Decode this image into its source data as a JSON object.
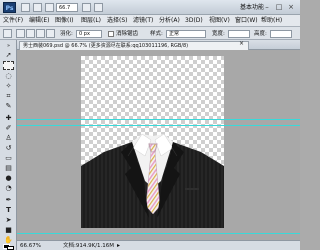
{
  "app": {
    "logo": "Ps",
    "zoom": "66.7",
    "workspace": "基本功能",
    "window_controls": [
      "–",
      "□",
      "×"
    ]
  },
  "menu": [
    "文件(F)",
    "编辑(E)",
    "图像(I)",
    "图层(L)",
    "选择(S)",
    "滤镜(T)",
    "分析(A)",
    "3D(D)",
    "视图(V)",
    "窗口(W)",
    "帮助(H)"
  ],
  "options": {
    "feather_label": "羽化:",
    "feather_value": "0 px",
    "antialias_label": "消除锯齿",
    "style_label": "样式:",
    "style_value": "正常",
    "width_label": "宽度:",
    "height_label": "高度:"
  },
  "document": {
    "tab_title": "男士西装069.psd @ 66.7% (更多资源尽在联系:qq103011196, RGB/8)",
    "close": "×"
  },
  "status": {
    "zoom": "66.67%",
    "doc_info": "文档:914.9K/1.16M"
  },
  "colors": {
    "guide": "#3ad9d9",
    "suit": "#1d1d1d",
    "shirt": "#f2f2f2",
    "tie_stripe_pink": "#e8a0c8",
    "tie_stripe_gold": "#d9b24a"
  },
  "icons": [
    "photoshop-logo",
    "hand-icon",
    "zoom-icon",
    "layout-icon",
    "move-tool-icon",
    "marquee-tool-icon",
    "lasso-tool-icon",
    "magic-wand-icon",
    "crop-tool-icon",
    "eyedropper-icon",
    "healing-brush-icon",
    "brush-tool-icon",
    "clone-stamp-icon",
    "history-brush-icon",
    "eraser-icon",
    "gradient-icon",
    "blur-icon",
    "dodge-icon",
    "pen-tool-icon",
    "type-tool-icon",
    "path-select-icon",
    "shape-tool-icon",
    "hand-tool-icon",
    "zoom-tool-icon",
    "color-swatch-icon"
  ]
}
